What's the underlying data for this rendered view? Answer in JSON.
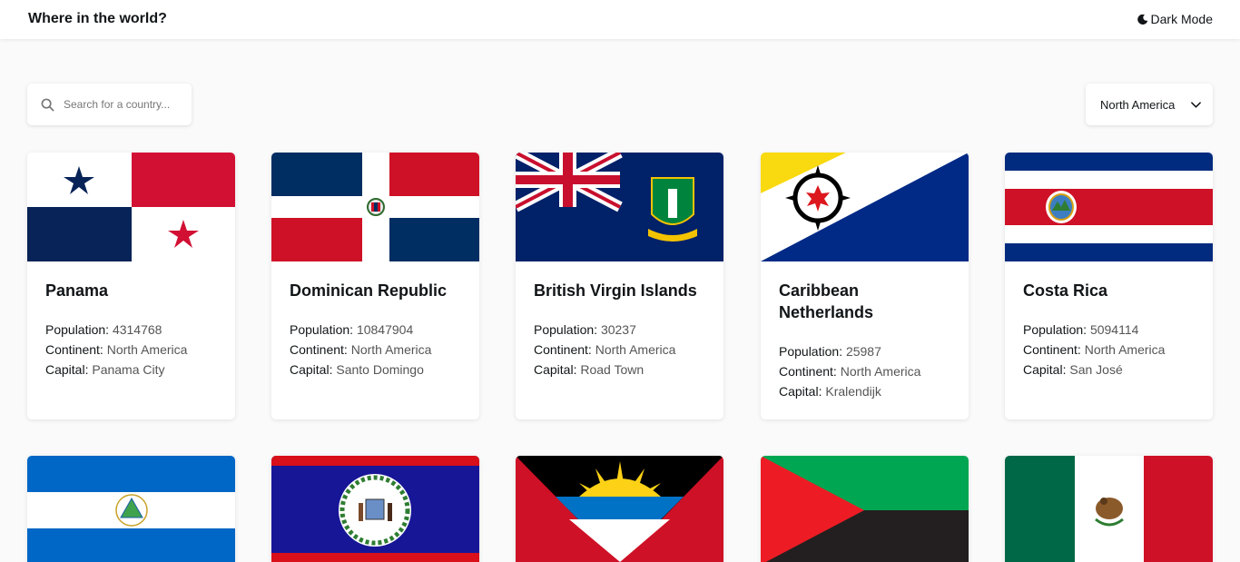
{
  "header": {
    "title": "Where in the world?",
    "mode_label": "Dark Mode",
    "mode_icon": "moon-icon"
  },
  "search": {
    "placeholder": "Search for a country...",
    "value": "",
    "icon": "search-icon"
  },
  "filter": {
    "selected": "North America",
    "icon": "chevron-down-icon"
  },
  "labels": {
    "population": "Population:",
    "continent": "Continent:",
    "capital": "Capital:"
  },
  "countries": [
    {
      "name": "Panama",
      "population": "4314768",
      "continent": "North America",
      "capital": "Panama City"
    },
    {
      "name": "Dominican Republic",
      "population": "10847904",
      "continent": "North America",
      "capital": "Santo Domingo"
    },
    {
      "name": "British Virgin Islands",
      "population": "30237",
      "continent": "North America",
      "capital": "Road Town"
    },
    {
      "name": "Caribbean Netherlands",
      "population": "25987",
      "continent": "North America",
      "capital": "Kralendijk"
    },
    {
      "name": "Costa Rica",
      "population": "5094114",
      "continent": "North America",
      "capital": "San José"
    }
  ],
  "second_row_flags": [
    "Nicaragua flag",
    "Belize flag",
    "Antigua and Barbuda flag",
    "Western Sahara flag",
    "Mexico flag"
  ],
  "colors": {
    "background": "#fafafa",
    "card": "#ffffff",
    "text": "#111517"
  }
}
